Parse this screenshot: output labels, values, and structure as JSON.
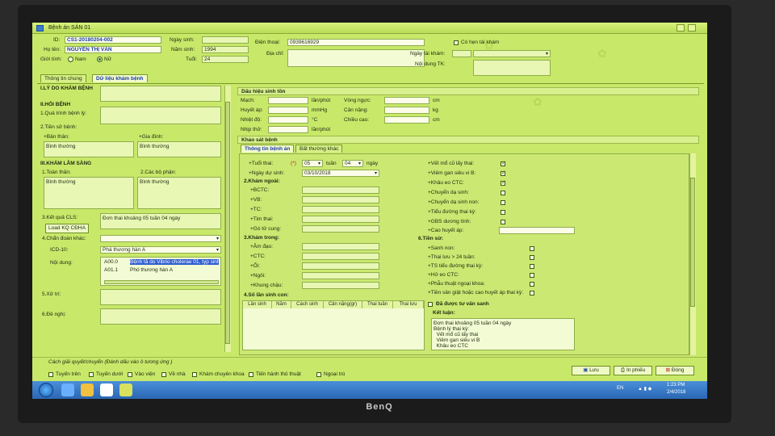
{
  "window": {
    "title": "Bệnh án SẢN 01"
  },
  "header": {
    "id_label": "ID:",
    "id_value": "CS1-20180204-002",
    "name_label": "Họ tên:",
    "name_value": "NGUYỄN THỊ VÂN",
    "gender_label": "Giới tính:",
    "gender_male": "Nam",
    "gender_female": "Nữ",
    "dob_label": "Ngày sinh:",
    "dob_value": "",
    "birth_year_label": "Năm sinh:",
    "birth_year_value": "1994",
    "age_label": "Tuổi:",
    "age_value": "24",
    "phone_label": "Điện thoại:",
    "phone_value": "0939616929",
    "address_label": "Địa chỉ:",
    "address_value": "",
    "revisit_label": "Có hẹn tái khám",
    "revisit_date_label": "Ngày tái khám:",
    "revisit_content_label": "Nội dung TK:"
  },
  "tabs": {
    "general": "Thông tin chung",
    "medical_data": "Dữ liệu khám bệnh"
  },
  "left": {
    "reason_label": "I.LÝ DO KHÁM BỆNH",
    "history_label": "II.HỎI BỆNH",
    "disease_process_label": "1.Quá trình bệnh lý:",
    "past_history_label": "2.Tiền sử bệnh:",
    "self_label": "+Bản thân:",
    "self_value": "Bình thường",
    "family_label": "+Gia đình:",
    "family_value": "Bình thường",
    "exam_label": "III.KHÁM LÂM SÀNG",
    "overall_label": "1.Toàn thân:",
    "overall_value": "Bình thường",
    "organs_label": "2.Các bộ phận:",
    "organs_value": "Bình thường",
    "cls_label": "3.Kết quả CLS:",
    "cls_value": "Đơn thai khoảng 05 tuần 04 ngày",
    "load_button": "Load KQ CĐHA",
    "diff_dx_label": "4.Chẩn đoán khác:",
    "icd_label": "ICD-10:",
    "icd_value": "Phá thương hàn A",
    "content_label": "Nội dung:",
    "icd_rows": [
      {
        "code": "A00.0",
        "text": "Bệnh tả do Vibrio cholerae 01, typ sinh..."
      },
      {
        "code": "A01.1",
        "text": "Phó thương hàn A"
      }
    ],
    "treatment_label": "5.Xử trí:",
    "advice_label": "6.Đề nghị:"
  },
  "vitals": {
    "header": "Dấu hiệu sinh tồn",
    "pulse_label": "Mạch:",
    "pulse_unit": "lần/phút",
    "bp_label": "Huyết áp:",
    "bp_unit": "mmHg",
    "temp_label": "Nhiệt độ:",
    "temp_unit": "°C",
    "resp_label": "Nhịp thở:",
    "resp_unit": "lần/phút",
    "chest_label": "Vòng ngực:",
    "chest_unit": "cm",
    "weight_label": "Cân nặng:",
    "weight_unit": "kg",
    "height_label": "Chiều cao:",
    "height_unit": "cm"
  },
  "exam": {
    "header": "Khảo sát bệnh",
    "tab_info": "Thông tin bệnh án",
    "tab_abnormal": "Bất thường khác",
    "gest_age_label": "+Tuổi thai:",
    "gest_marker": "(*)",
    "gest_weeks": "05",
    "weeks_unit": "tuần",
    "gest_days": "04",
    "days_unit": "ngày",
    "due_date_label": "+Ngày dự sinh:",
    "due_date_value": "03/10/2018",
    "external_label": "2.Khám ngoài:",
    "bctc": "+BCTC:",
    "vb": "+VB:",
    "tc": "+TC:",
    "tim_thai": "+Tim thai:",
    "go_tu_cung": "+Gò tử cung:",
    "internal_label": "3.Khám trong:",
    "am_dao": "+Âm đạo:",
    "ctc": "+CTC:",
    "oi": "+Ối:",
    "ngoi": "+Ngôi:",
    "khung_chau": "+Khung chậu:",
    "births_label": "4.Số lần sinh con:",
    "births_cols": [
      "Lần sinh",
      "Năm",
      "Cách sinh",
      "Cân nặng(gr)",
      "Thai tuần",
      "Thai lưu"
    ],
    "right_items": [
      {
        "label": "+Vết mổ cũ lấy thai:",
        "checked": true
      },
      {
        "label": "+Viêm gan siêu vi B:",
        "checked": true
      },
      {
        "label": "+Khâu eo CTC:",
        "checked": true
      },
      {
        "label": "+Chuyển dạ sinh:",
        "checked": false
      },
      {
        "label": "+Chuyển dạ sinh non:",
        "checked": false
      },
      {
        "label": "+Tiểu đường thai kỳ:",
        "checked": false
      },
      {
        "label": "+GBS dương tính:",
        "checked": false
      }
    ],
    "hypertension_label": "+Cao huyết áp:",
    "tien_su_label": "6.Tiền sử:",
    "history_items": [
      {
        "label": "+Sanh non:"
      },
      {
        "label": "+Thai lưu > 24 tuần:"
      },
      {
        "label": "+TS tiểu đường thai kỳ:"
      },
      {
        "label": "+Hở eo CTC:"
      },
      {
        "label": "+Phẫu thuật ngoại khoa:"
      },
      {
        "label": "+Tiền sản giật hoặc cao huyết áp thai kỳ:"
      }
    ],
    "counsel_label": "Đã được tư vấn sanh",
    "conclusion_label": "Kết luận:",
    "conclusion_lines": [
      "Đơn thai khoảng 05 tuần 04 ngày",
      "Bệnh lý thai kỳ:",
      "  Vết mổ cũ lấy thai",
      "  Viêm gan siêu vi B",
      "  Khâu eo CTC"
    ]
  },
  "footer": {
    "resolution_label": "Cách giải quyết/chuyển (Đánh dấu vào ô tương ứng )",
    "options": [
      "Tuyến trên",
      "Tuyến dưới",
      "Vào viện",
      "Về nhà",
      "Khám chuyên khoa",
      "Tiến hành thủ thuật",
      "Ngoại trú"
    ],
    "save_button": "Lưu",
    "print_button": "In phiếu",
    "close_button": "Đóng"
  },
  "taskbar": {
    "lang": "EN",
    "time": "1:23 PM",
    "date": "2/4/2018"
  },
  "monitor": {
    "brand": "BenQ"
  },
  "colors": {
    "screen_bg": "#c8e86a",
    "accent_blue": "#1a3aa8"
  }
}
